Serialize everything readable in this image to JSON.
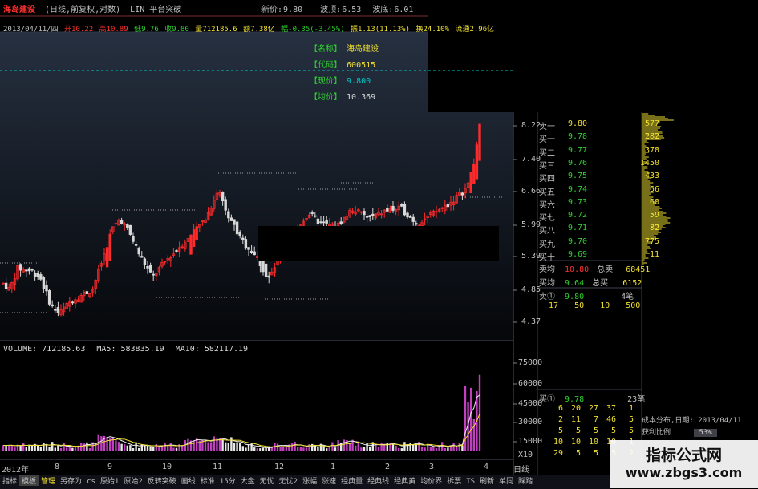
{
  "header": {
    "stock_name": "海岛建设",
    "chart_mode": "(日线,前复权,对数)",
    "indicator": "LIN_平台突破",
    "new_price_label": "新价:",
    "new_price": "9.80",
    "wave_top_label": "波顶:",
    "wave_top": "6.53",
    "wave_bottom_label": "波底:",
    "wave_bottom": "6.01"
  },
  "quote_line": {
    "date": "2013/04/11/四",
    "open": "开10.22",
    "high": "高10.89",
    "low": "低9.76",
    "close": "收9.80",
    "volume": "量712185.6",
    "amount": "额7.38亿",
    "change": "幅-0.35(-3.45%)",
    "amplitude": "振1.13(11.13%)",
    "turnover": "换24.10%",
    "float": "流通2.96亿"
  },
  "info_box": {
    "rows": [
      {
        "label": "【名称】",
        "value": "海岛建设"
      },
      {
        "label": "【代码】",
        "value": "600515"
      },
      {
        "label": "【现价】",
        "value": "9.800"
      },
      {
        "label": "【均价】",
        "value": "10.369"
      }
    ]
  },
  "price_axis": [
    "8.22",
    "7.40",
    "6.66",
    "5.99",
    "5.39",
    "4.85",
    "4.37"
  ],
  "volume_axis": [
    "75000",
    "60000",
    "45000",
    "30000",
    "15000",
    "X10"
  ],
  "volume_header": {
    "volume": "VOLUME: 712185.63",
    "ma5": "MA5: 583835.19",
    "ma10": "MA10: 582117.19"
  },
  "x_axis": [
    "2012年",
    "8",
    "9",
    "10",
    "11",
    "12",
    "1",
    "2",
    "3",
    "4",
    "日线"
  ],
  "order_book": {
    "rows": [
      {
        "label": "卖一",
        "price": "9.80",
        "qty": "577"
      },
      {
        "label": "买一",
        "price": "9.78",
        "qty": "282"
      },
      {
        "label": "买二",
        "price": "9.77",
        "qty": "378"
      },
      {
        "label": "买三",
        "price": "9.76",
        "qty": "1450"
      },
      {
        "label": "买四",
        "price": "9.75",
        "qty": "433"
      },
      {
        "label": "买五",
        "price": "9.74",
        "qty": "56"
      },
      {
        "label": "买六",
        "price": "9.73",
        "qty": "68"
      },
      {
        "label": "买七",
        "price": "9.72",
        "qty": "59"
      },
      {
        "label": "买八",
        "price": "9.71",
        "qty": "82"
      },
      {
        "label": "买九",
        "price": "9.70",
        "qty": "775"
      },
      {
        "label": "买十",
        "price": "9.69",
        "qty": "11"
      }
    ],
    "sell_avg_label": "卖均",
    "sell_avg": "10.80",
    "total_sell_label": "总卖",
    "total_sell": "68451",
    "buy_avg_label": "买均",
    "buy_avg": "9.64",
    "total_buy_label": "总买",
    "total_buy": "6152",
    "sell1_detail_label": "卖①",
    "sell1_detail_price": "9.80",
    "sell1_detail_count": "4笔",
    "sell1_queue": [
      "17",
      "50",
      "10",
      "500"
    ],
    "buy1_detail_label": "买①",
    "buy1_detail_price": "9.78",
    "buy1_detail_count": "23笔",
    "buy1_queue": [
      [
        "6",
        "20",
        "27",
        "37",
        "1"
      ],
      [
        "2",
        "11",
        "7",
        "46",
        "5"
      ],
      [
        "5",
        "5",
        "5",
        "5",
        "5"
      ],
      [
        "10",
        "10",
        "10",
        "10",
        "1"
      ],
      [
        "29",
        "5",
        "5",
        "5",
        "2"
      ]
    ]
  },
  "cost_panel": {
    "title": "成本分布,日期: 2013/04/11",
    "profit_label": "获利比例",
    "profit_value": "53%"
  },
  "tabs": [
    "指标",
    "模板",
    "管理",
    "另存为",
    "cs",
    "原始1",
    "原始2",
    "反转突破",
    "画线",
    "标准",
    "15分",
    "大盘",
    "无忧",
    "无忧2",
    "涨幅",
    "涨速",
    "经典量",
    "经典线",
    "经典黄",
    "均价界",
    "拆票",
    "TS",
    "刷新",
    "单同",
    "踩踏"
  ],
  "watermark": {
    "title": "指标公式网",
    "url": "www.zbgs3.com"
  },
  "colors": {
    "up": "#ff2a2a",
    "down": "#d8d8d8",
    "yellow": "#f0e030",
    "purple": "#c040c0",
    "green": "#30d030",
    "header_red": "#ff3030",
    "cyan_line": "#00c8c8"
  }
}
